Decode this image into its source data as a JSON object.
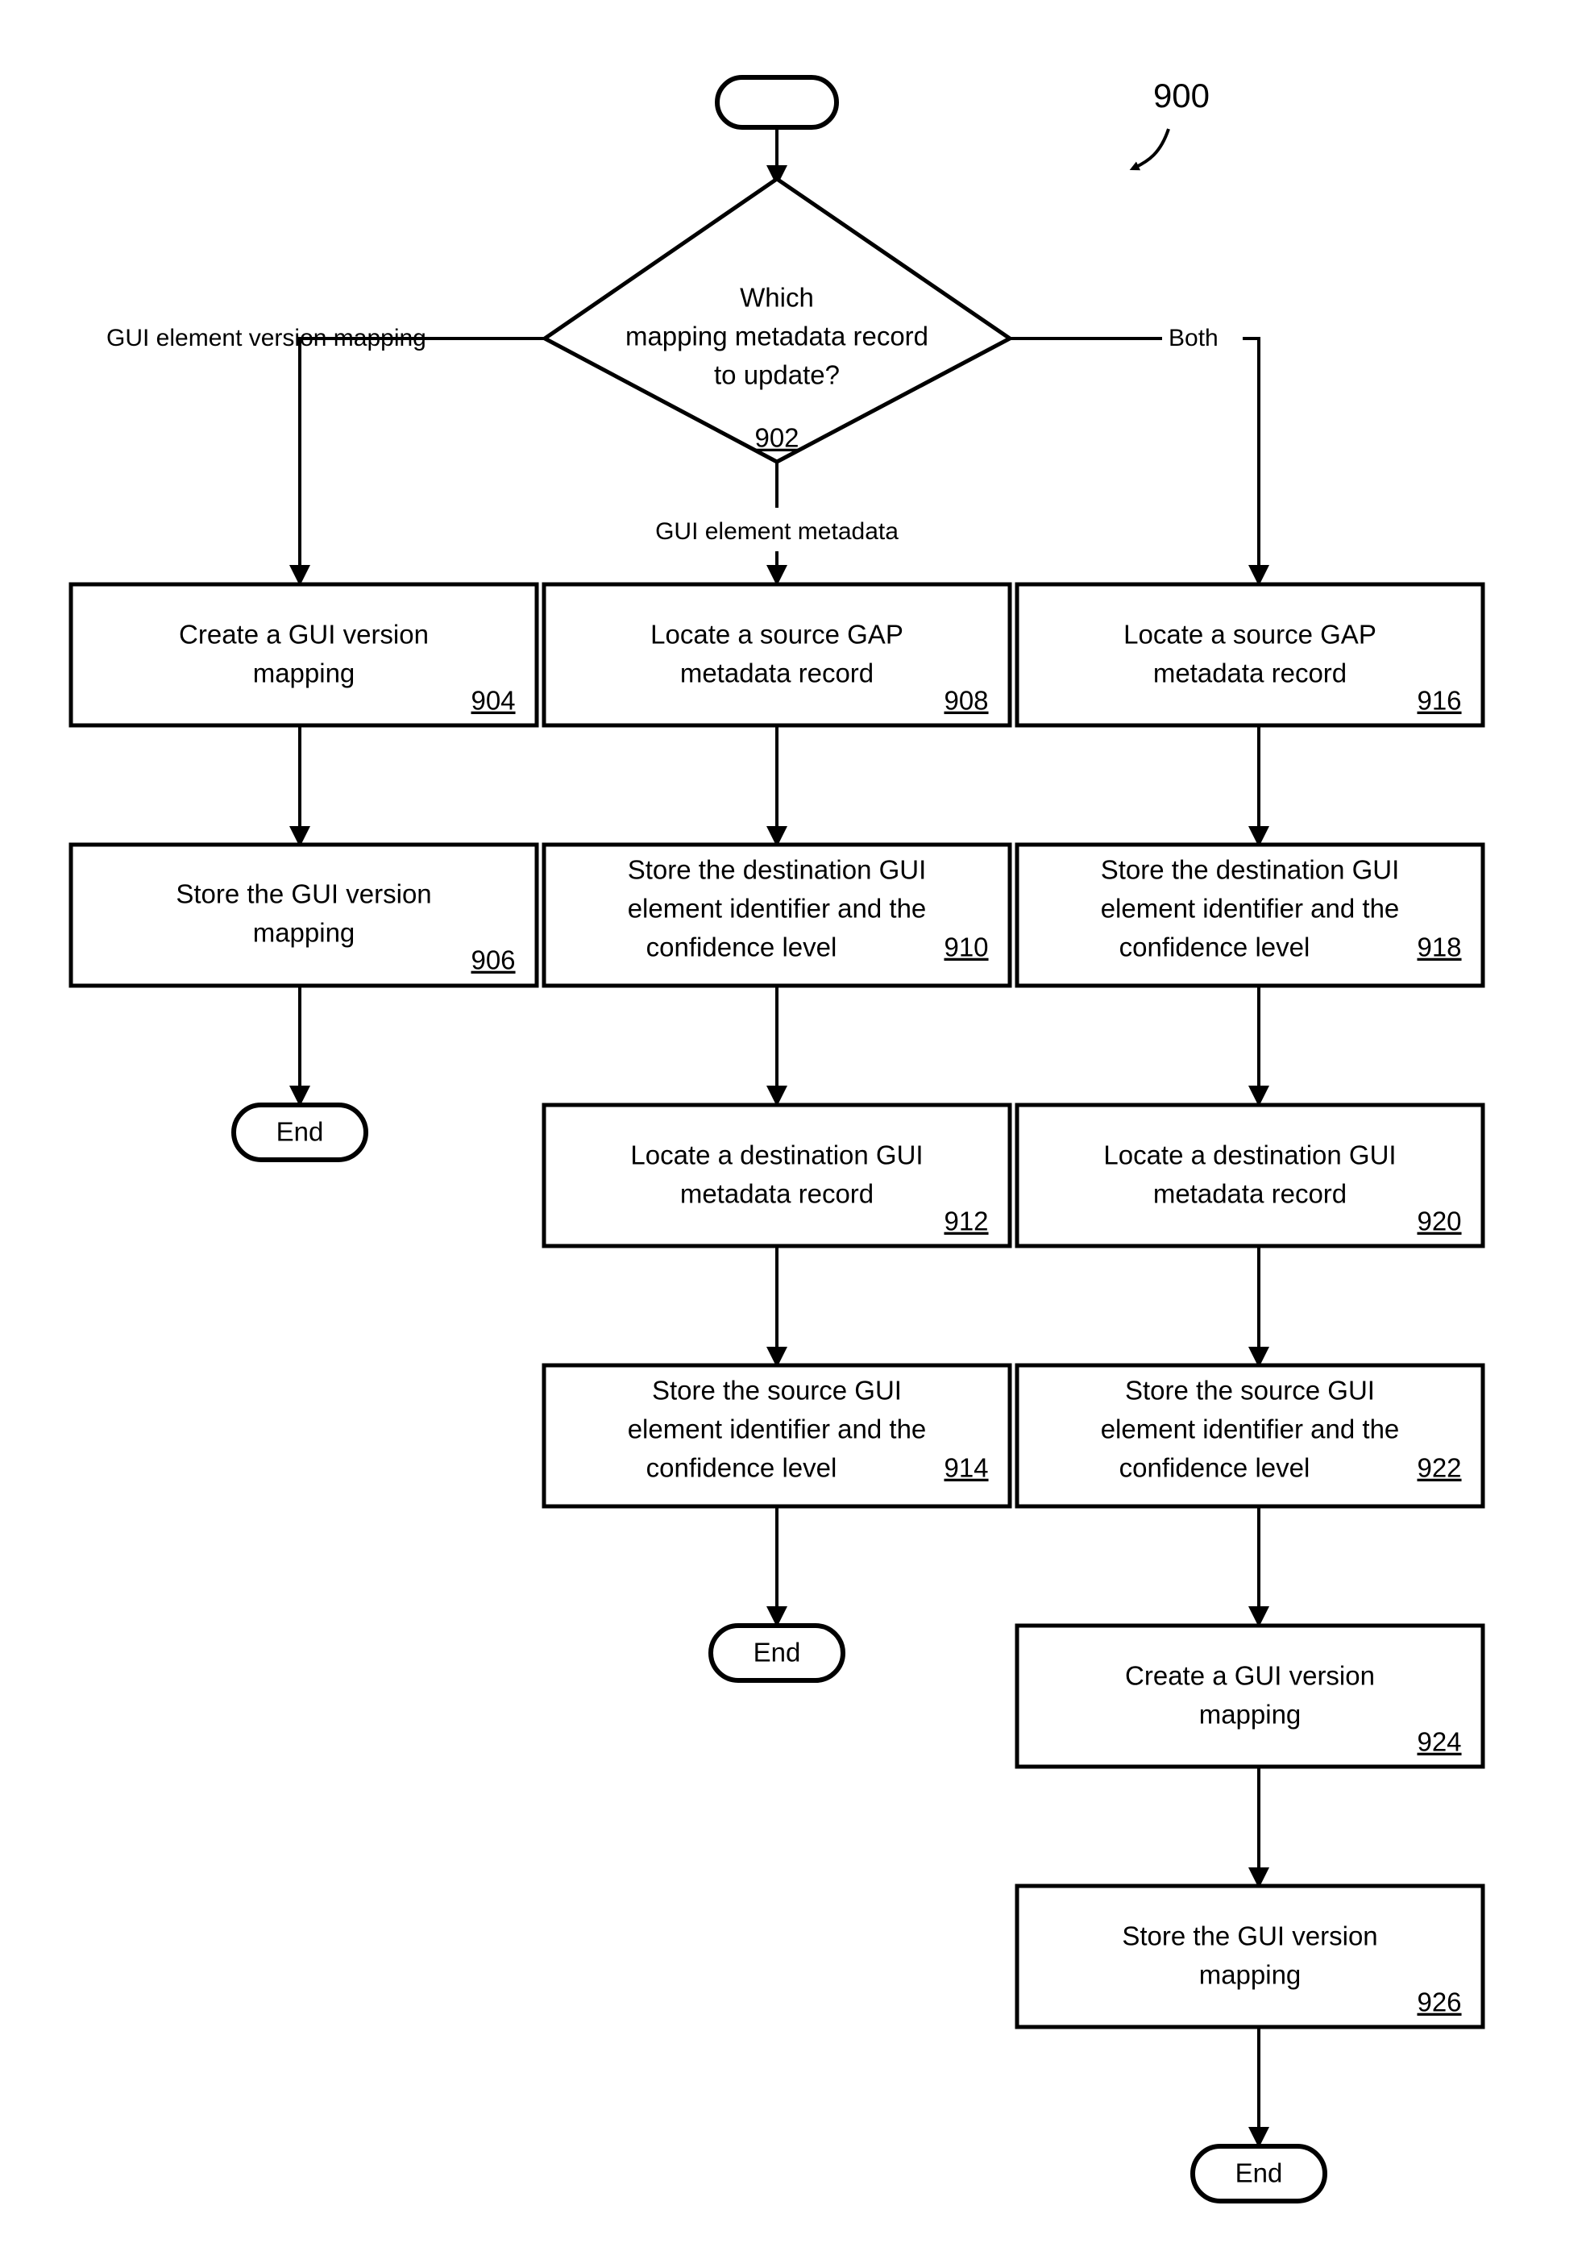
{
  "figure": {
    "number": "900",
    "type": "process-flowchart"
  },
  "terminators": {
    "start": "",
    "end_left": "End",
    "end_middle": "End",
    "end_right": "End"
  },
  "decision": {
    "line1": "Which",
    "line2": "mapping metadata record",
    "line3": "to update?",
    "ref": "902"
  },
  "edge_labels": {
    "left": "GUI element version mapping",
    "middle": "GUI element metadata",
    "right": "Both"
  },
  "nodes": {
    "n904": {
      "line1": "Create a GUI version",
      "line2": "mapping",
      "line3": "",
      "ref": "904"
    },
    "n906": {
      "line1": "Store the GUI version",
      "line2": "mapping",
      "line3": "",
      "ref": "906"
    },
    "n908": {
      "line1": "Locate a source GAP",
      "line2": "metadata record",
      "line3": "",
      "ref": "908"
    },
    "n910": {
      "line1": "Store the destination GUI",
      "line2": "element identifier and the",
      "line3": "confidence level",
      "ref": "910"
    },
    "n912": {
      "line1": "Locate a destination GUI",
      "line2": "metadata record",
      "line3": "",
      "ref": "912"
    },
    "n914": {
      "line1": "Store the source GUI",
      "line2": "element identifier and the",
      "line3": "confidence level",
      "ref": "914"
    },
    "n916": {
      "line1": "Locate a source GAP",
      "line2": "metadata record",
      "line3": "",
      "ref": "916"
    },
    "n918": {
      "line1": "Store the destination GUI",
      "line2": "element identifier and the",
      "line3": "confidence level",
      "ref": "918"
    },
    "n920": {
      "line1": "Locate a destination GUI",
      "line2": "metadata record",
      "line3": "",
      "ref": "920"
    },
    "n922": {
      "line1": "Store the source GUI",
      "line2": "element identifier and the",
      "line3": "confidence level",
      "ref": "922"
    },
    "n924": {
      "line1": "Create a GUI version",
      "line2": "mapping",
      "line3": "",
      "ref": "924"
    },
    "n926": {
      "line1": "Store the GUI version",
      "line2": "mapping",
      "line3": "",
      "ref": "926"
    }
  },
  "colors": {
    "stroke": "#000000",
    "fill": "#ffffff",
    "text": "#000000"
  }
}
